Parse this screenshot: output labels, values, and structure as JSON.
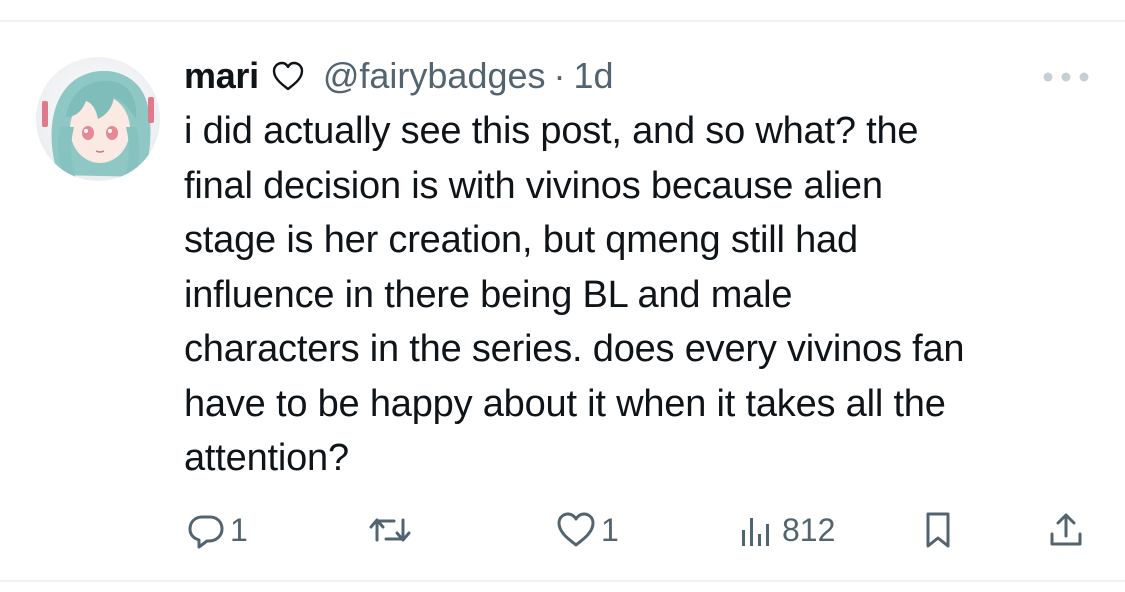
{
  "tweet": {
    "display_name": "mari",
    "handle": "@fairybadges",
    "separator": "·",
    "time": "1d",
    "text": "i did actually see this post, and so what? the\nfinal decision is with vivinos because alien\nstage is her creation, but qmeng still had\ninfluence in there being BL and male\ncharacters in the series. does every vivinos fan\nhave to be happy about it when it takes all the\nattention?",
    "badge_icon": "heart-outline-icon",
    "avatar_icon": "anime-avatar"
  },
  "actions": {
    "reply_count": "1",
    "retweet_count": "",
    "like_count": "1",
    "views_count": "812"
  },
  "colors": {
    "text_primary": "#0f1419",
    "text_secondary": "#536471",
    "divider": "#eff3f4",
    "icon": "#536471"
  }
}
